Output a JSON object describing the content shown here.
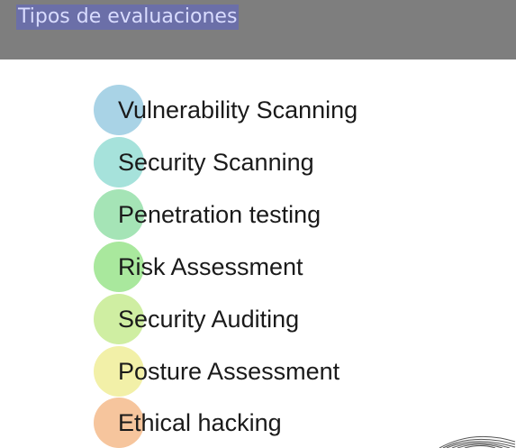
{
  "header": {
    "title": "Tipos de evaluaciones"
  },
  "colors": {
    "header_bg": "#7e7e7e",
    "title_bg": "#6b6fa8",
    "title_text": "#d9dcff"
  },
  "list": {
    "items": [
      {
        "label": "Vulnerability Scanning",
        "color": "#a9d3e6"
      },
      {
        "label": "Security Scanning",
        "color": "#a6e2db"
      },
      {
        "label": "Penetration testing",
        "color": "#a5e4b6"
      },
      {
        "label": "Risk Assessment",
        "color": "#a9e89d"
      },
      {
        "label": "Security Auditing",
        "color": "#cfeea2"
      },
      {
        "label": "Posture Assessment",
        "color": "#f2f0a8"
      },
      {
        "label": "Ethical hacking",
        "color": "#f6c59d"
      }
    ]
  }
}
